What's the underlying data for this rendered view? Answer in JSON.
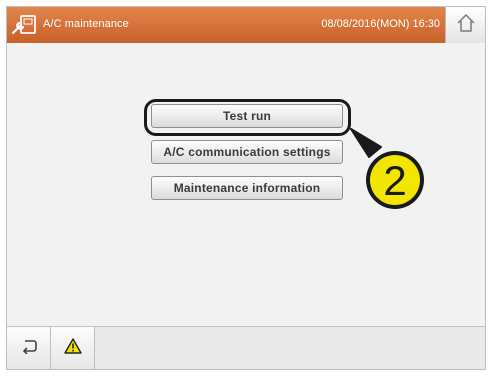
{
  "header": {
    "title": "A/C maintenance",
    "datetime": "08/08/2016(MON) 16:30",
    "app_icon": "wrench-remote-icon",
    "home_icon": "home-icon"
  },
  "menu": {
    "items": [
      {
        "label": "Test run"
      },
      {
        "label": "A/C communication settings"
      },
      {
        "label": "Maintenance information"
      }
    ]
  },
  "callout": {
    "number": "2",
    "color": "#f2e500"
  },
  "footer": {
    "back_icon": "back-arrow-icon",
    "warning_icon": "warning-icon"
  },
  "colors": {
    "header_orange": "#d8723a",
    "background": "#f2f2f2",
    "button_border": "#8f8f8f"
  }
}
